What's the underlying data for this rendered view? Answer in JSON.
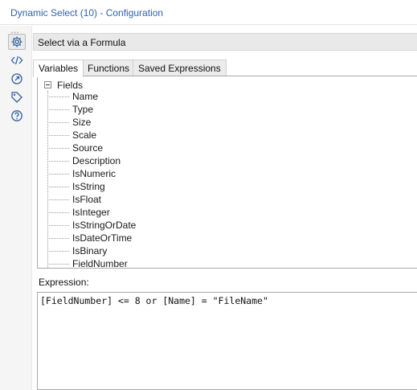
{
  "window": {
    "title": "Dynamic Select (10) - Configuration"
  },
  "sidebar": {
    "dots": "…",
    "buttons": [
      {
        "icon": "gear-icon",
        "active": true
      },
      {
        "icon": "code-icon",
        "active": false
      },
      {
        "icon": "target-icon",
        "active": false
      },
      {
        "icon": "tag-icon",
        "active": false
      },
      {
        "icon": "help-icon",
        "active": false
      }
    ]
  },
  "mode": {
    "label": "Select via a Formula"
  },
  "tabs": [
    {
      "label": "Variables",
      "active": true
    },
    {
      "label": "Functions",
      "active": false
    },
    {
      "label": "Saved Expressions",
      "active": false
    }
  ],
  "tree": {
    "root": "Fields",
    "items": [
      "Name",
      "Type",
      "Size",
      "Scale",
      "Source",
      "Description",
      "IsNumeric",
      "IsString",
      "IsFloat",
      "IsInteger",
      "IsStringOrDate",
      "IsDateOrTime",
      "IsBinary",
      "FieldNumber"
    ]
  },
  "expression": {
    "label": "Expression:",
    "value": "[FieldNumber] <= 8 or [Name] = \"FileName\""
  },
  "colors": {
    "title": "#2e64ad",
    "icon": "#2f5f9e"
  }
}
